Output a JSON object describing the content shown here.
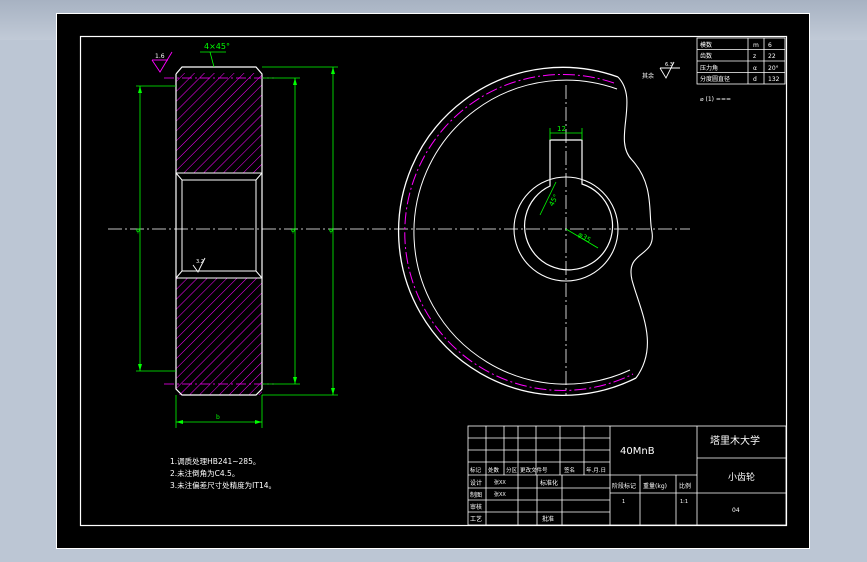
{
  "title_block": {
    "university": "塔里木大学",
    "material": "40MnB",
    "part_name": "小齿轮",
    "header_row": [
      "标记",
      "处数",
      "分区",
      "更改文件号",
      "签名",
      "年.月.日"
    ],
    "left_rows": [
      "设计",
      "制图",
      "审核",
      "工艺"
    ],
    "row_values": [
      "张XX",
      "张XX"
    ],
    "mid_labels": [
      "标准化",
      "批准"
    ],
    "right_labels": [
      "阶段标记",
      "重量(kg)",
      "比例"
    ],
    "values": [
      "1",
      "1:1"
    ],
    "sheet_no": "04"
  },
  "notes": [
    "1.调质处理HB241~285。",
    "2.未注倒角为C4.5。",
    "3.未注偏差尺寸处精度为IT14。"
  ],
  "param_table": {
    "rows": [
      [
        "模数",
        "m",
        "6"
      ],
      [
        "齿数",
        "z",
        "22"
      ],
      [
        "压力角",
        "α",
        "20°"
      ],
      [
        "分度圆直径",
        "d",
        "132"
      ]
    ],
    "note": "其余"
  },
  "dimensions": {
    "chamfer": "4×45°",
    "keyway": "12",
    "bore_angle": "45°",
    "bore_dia": "φ35",
    "roughness_side": "1.6",
    "roughness_bore": "3.2",
    "roughness_other": "6.3",
    "d_root": "φ",
    "d_pitch": "φ",
    "d_tip": "φ",
    "bore_left": "φ",
    "width": "b"
  },
  "colors": {
    "sheet": "#000000",
    "frame": "#ffffff",
    "dimension": "#00ff00",
    "pitch_line": "#ff00ff",
    "hatch": "#ff00ff",
    "outline": "#ffffff"
  }
}
